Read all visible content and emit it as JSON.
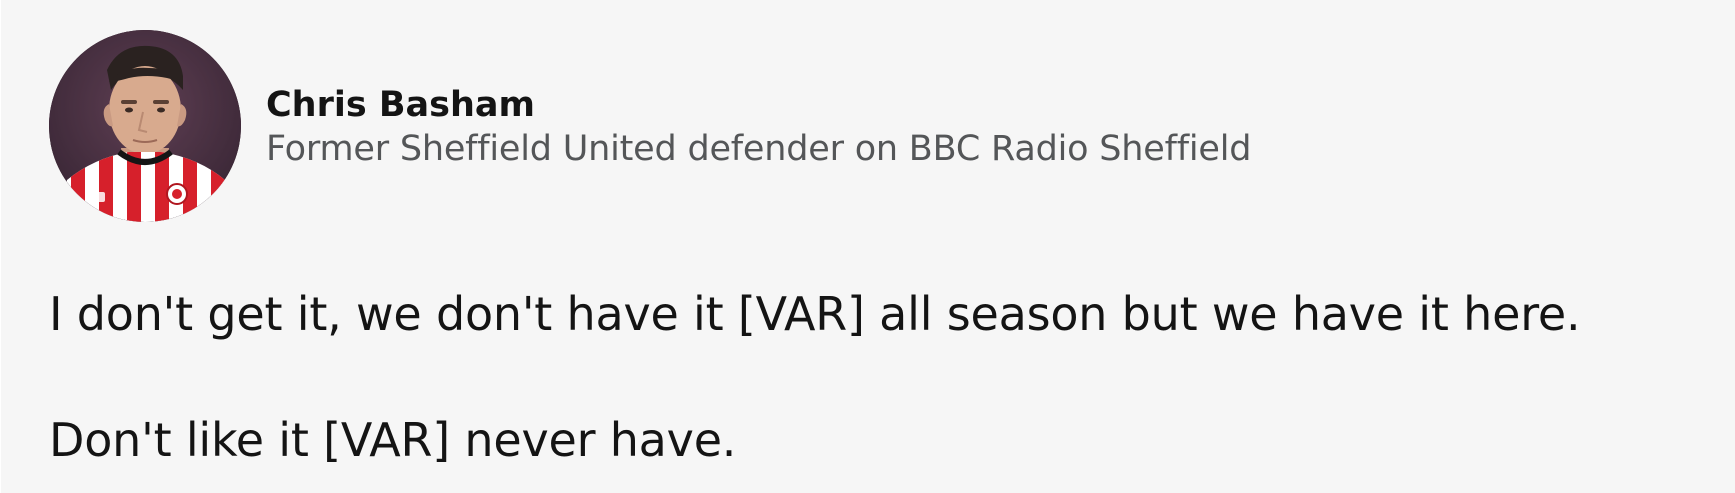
{
  "contributor": {
    "name": "Chris Basham",
    "role": "Former Sheffield United defender on BBC Radio Sheffield"
  },
  "quote": {
    "paragraphs": [
      "I don't get it, we don't have it [VAR] all season but we have it here.",
      "Don't like it [VAR] never have."
    ]
  },
  "colors": {
    "card_background": "#f6f6f6",
    "name_text": "#141414",
    "role_text": "#545658",
    "body_text": "#141414",
    "shirt_red": "#d6202b",
    "shirt_white": "#ffffff"
  }
}
